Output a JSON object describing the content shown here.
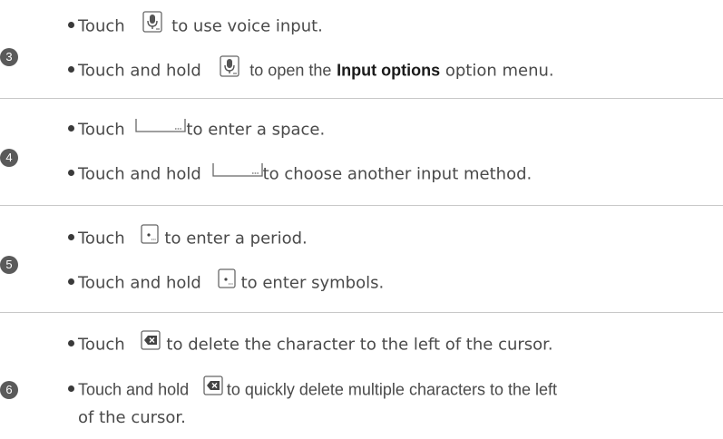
{
  "sections": [
    {
      "number": "3",
      "items": [
        {
          "pre": "Touch",
          "post": "to use voice input."
        },
        {
          "pre": "Touch and hold",
          "post_a": "to open the",
          "bold": "Input options",
          "post_b": "option menu."
        }
      ]
    },
    {
      "number": "4",
      "items": [
        {
          "pre": "Touch",
          "post": "to enter a space."
        },
        {
          "pre": "Touch and hold",
          "post": "to choose another input method."
        }
      ]
    },
    {
      "number": "5",
      "items": [
        {
          "pre": "Touch",
          "post": "to enter a period."
        },
        {
          "pre": "Touch and hold",
          "post": "to enter symbols."
        }
      ]
    },
    {
      "number": "6",
      "items": [
        {
          "pre": "Touch",
          "post": "to delete the character to the left of the cursor."
        },
        {
          "pre": "Touch and hold",
          "post": "to quickly delete multiple characters to the left",
          "cont": "of the cursor."
        }
      ]
    }
  ],
  "icons": {
    "mic": "microphone-key-icon",
    "space": "space-key-icon",
    "period": "period-key-icon",
    "delete": "delete-key-icon"
  },
  "colors": {
    "text": "#4a4a4a",
    "bold_text": "#1a1a1a",
    "badge": "#5a5a5a",
    "divider": "#c8c8c8"
  }
}
